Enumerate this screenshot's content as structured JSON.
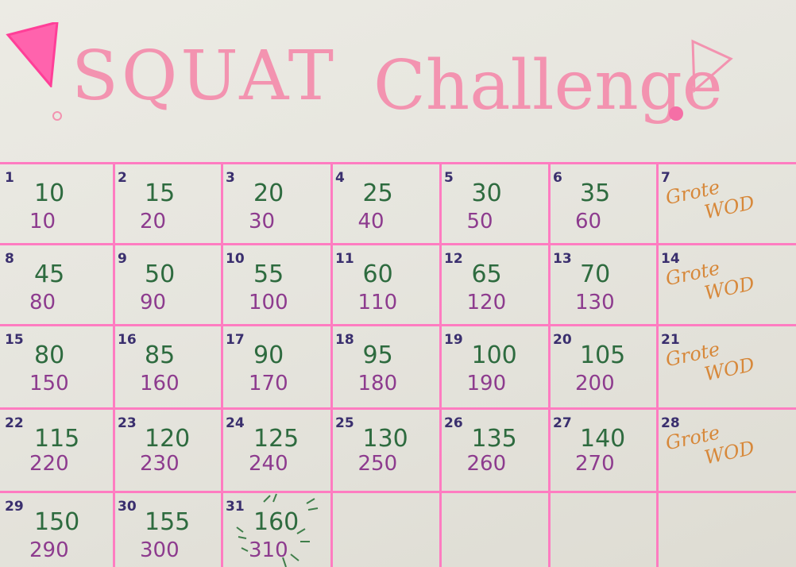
{
  "title": {
    "word1": "SQUAT",
    "word2": "Challenge"
  },
  "colors": {
    "pink_grid": "#ff7cc1",
    "title_pink": "#f393b0",
    "rep_green": "#2e6b3f",
    "cum_purple": "#8d3b8e",
    "wod_orange": "#d7883a",
    "day_navy": "#3a2f6e"
  },
  "rows": [
    [
      {
        "day": "1",
        "rep": "10",
        "cum": "10"
      },
      {
        "day": "2",
        "rep": "15",
        "cum": "20"
      },
      {
        "day": "3",
        "rep": "20",
        "cum": "30"
      },
      {
        "day": "4",
        "rep": "25",
        "cum": "40"
      },
      {
        "day": "5",
        "rep": "30",
        "cum": "50"
      },
      {
        "day": "6",
        "rep": "35",
        "cum": "60"
      },
      {
        "day": "7",
        "wod1": "Grote",
        "wod2": "WOD"
      }
    ],
    [
      {
        "day": "8",
        "rep": "45",
        "cum": "80"
      },
      {
        "day": "9",
        "rep": "50",
        "cum": "90"
      },
      {
        "day": "10",
        "rep": "55",
        "cum": "100"
      },
      {
        "day": "11",
        "rep": "60",
        "cum": "110"
      },
      {
        "day": "12",
        "rep": "65",
        "cum": "120"
      },
      {
        "day": "13",
        "rep": "70",
        "cum": "130"
      },
      {
        "day": "14",
        "wod1": "Grote",
        "wod2": "WOD"
      }
    ],
    [
      {
        "day": "15",
        "rep": "80",
        "cum": "150"
      },
      {
        "day": "16",
        "rep": "85",
        "cum": "160"
      },
      {
        "day": "17",
        "rep": "90",
        "cum": "170"
      },
      {
        "day": "18",
        "rep": "95",
        "cum": "180"
      },
      {
        "day": "19",
        "rep": "100",
        "cum": "190"
      },
      {
        "day": "20",
        "rep": "105",
        "cum": "200"
      },
      {
        "day": "21",
        "wod1": "Grote",
        "wod2": "WOD"
      }
    ],
    [
      {
        "day": "22",
        "rep": "115",
        "cum": "220"
      },
      {
        "day": "23",
        "rep": "120",
        "cum": "230"
      },
      {
        "day": "24",
        "rep": "125",
        "cum": "240"
      },
      {
        "day": "25",
        "rep": "130",
        "cum": "250"
      },
      {
        "day": "26",
        "rep": "135",
        "cum": "260"
      },
      {
        "day": "27",
        "rep": "140",
        "cum": "270"
      },
      {
        "day": "28",
        "wod1": "Grote",
        "wod2": "WOD"
      }
    ],
    [
      {
        "day": "29",
        "rep": "150",
        "cum": "290"
      },
      {
        "day": "30",
        "rep": "155",
        "cum": "300"
      },
      {
        "day": "31",
        "rep": "160",
        "cum": "310"
      },
      {},
      {},
      {},
      {}
    ]
  ]
}
